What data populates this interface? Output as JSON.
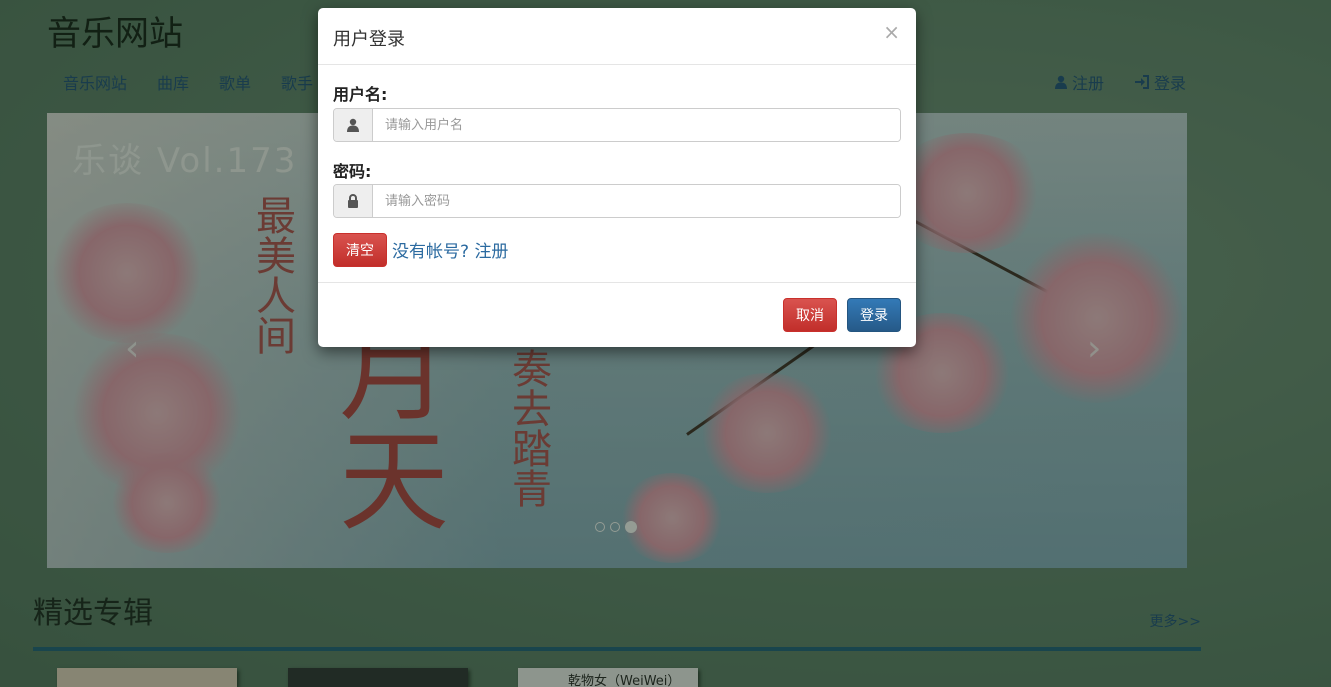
{
  "site": {
    "title": "音乐网站",
    "nav": [
      "音乐网站",
      "曲库",
      "歌单",
      "歌手"
    ],
    "nav_right": [
      {
        "icon": "user-icon",
        "label": "注册"
      },
      {
        "icon": "login-icon",
        "label": "登录"
      }
    ]
  },
  "carousel": {
    "brand": "乐谈",
    "volume": "Vol.173",
    "vertical_text_1": "最美人间",
    "big_text": "月天",
    "vertical_text_2": "奏去踏青",
    "prev": "‹",
    "next": "›",
    "slide_count": 3,
    "active_slide": 3
  },
  "section": {
    "title": "精选专辑",
    "more": "更多>>",
    "albums": [
      "",
      "",
      "乾物女（WeiWei）"
    ]
  },
  "modal": {
    "title": "用户登录",
    "close": "×",
    "username_label": "用户名:",
    "username_placeholder": "请输入用户名",
    "password_label": "密码:",
    "password_placeholder": "请输入密码",
    "clear_label": "清空",
    "no_account_text": "没有帐号?",
    "register_label": "注册",
    "cancel_label": "取消",
    "login_label": "登录"
  },
  "colors": {
    "link": "#2b6aa0",
    "danger": "#d9534f",
    "primary": "#337ab7"
  }
}
